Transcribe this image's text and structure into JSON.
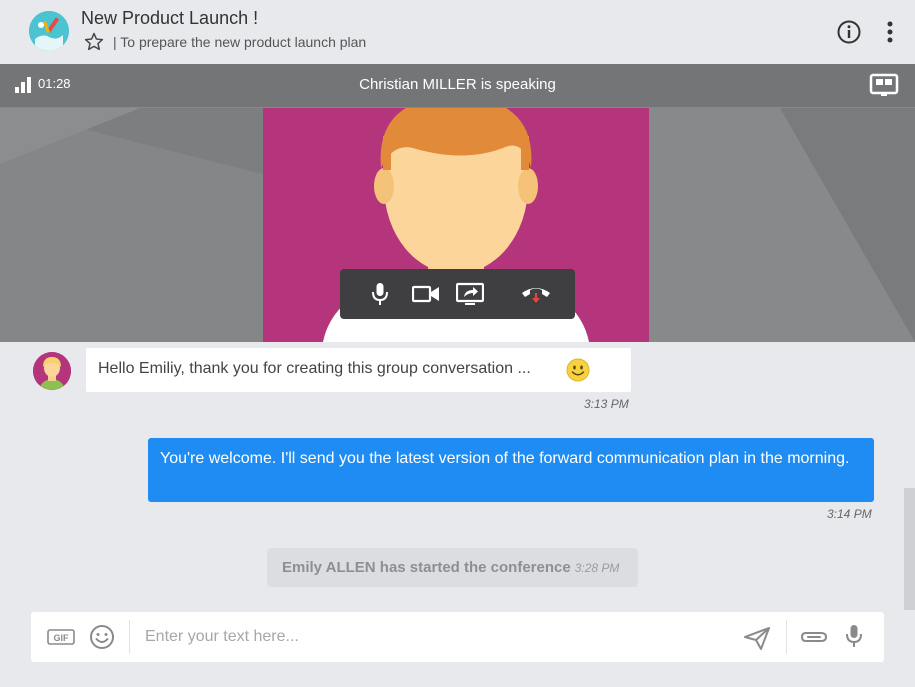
{
  "header": {
    "title": "New Product Launch !",
    "subtitle": "| To prepare the new product launch plan",
    "icons": [
      "group-avatar",
      "star-icon",
      "info-icon",
      "more-vertical-icon"
    ]
  },
  "call": {
    "timer": "01:28",
    "speaker_status": "Christian MILLER is speaking",
    "icons": [
      "signal-icon",
      "screen-layout-icon",
      "microphone-icon",
      "camera-icon",
      "share-screen-icon",
      "hang-up-icon"
    ]
  },
  "messages": [
    {
      "direction": "incoming",
      "text": "Hello Emiliy, thank you for creating this group conversation ...",
      "time": "3:13 PM",
      "emoji": "smile"
    },
    {
      "direction": "outgoing",
      "text": "You're welcome. I'll send you the latest version of the forward communication plan in the morning.",
      "time": "3:14 PM"
    }
  ],
  "system_message": {
    "text": "Emily ALLEN has started the conference",
    "time": "3:28 PM"
  },
  "composer": {
    "placeholder": "Enter your text here...",
    "value": "",
    "gif_label": "GIF"
  },
  "colors": {
    "accent": "#1e8cf2",
    "participant_bg": "#b5357d",
    "hangup": "#e5463b",
    "background": "#e8e9ec"
  }
}
